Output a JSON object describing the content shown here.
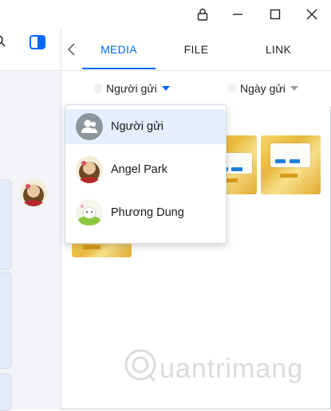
{
  "window": {
    "lock_icon": "lock-icon",
    "minimize_icon": "minimize-icon",
    "maximize_icon": "maximize-icon",
    "close_icon": "close-icon"
  },
  "tabs": [
    {
      "label": "MEDIA",
      "active": true
    },
    {
      "label": "FILE",
      "active": false
    },
    {
      "label": "LINK",
      "active": false
    }
  ],
  "filters": {
    "sender_label": "Người gửi",
    "date_label": "Ngày gửi"
  },
  "dropdown": {
    "items": [
      {
        "label": "Người gửi",
        "icon": "group-icon",
        "selected": true
      },
      {
        "label": "Angel Park",
        "icon": "avatar",
        "selected": false
      },
      {
        "label": "Phương Dung",
        "icon": "avatar",
        "selected": false
      }
    ]
  },
  "colors": {
    "accent": "#0068ff",
    "selected_bg": "#e5efff"
  },
  "watermark": "Quantrimang"
}
